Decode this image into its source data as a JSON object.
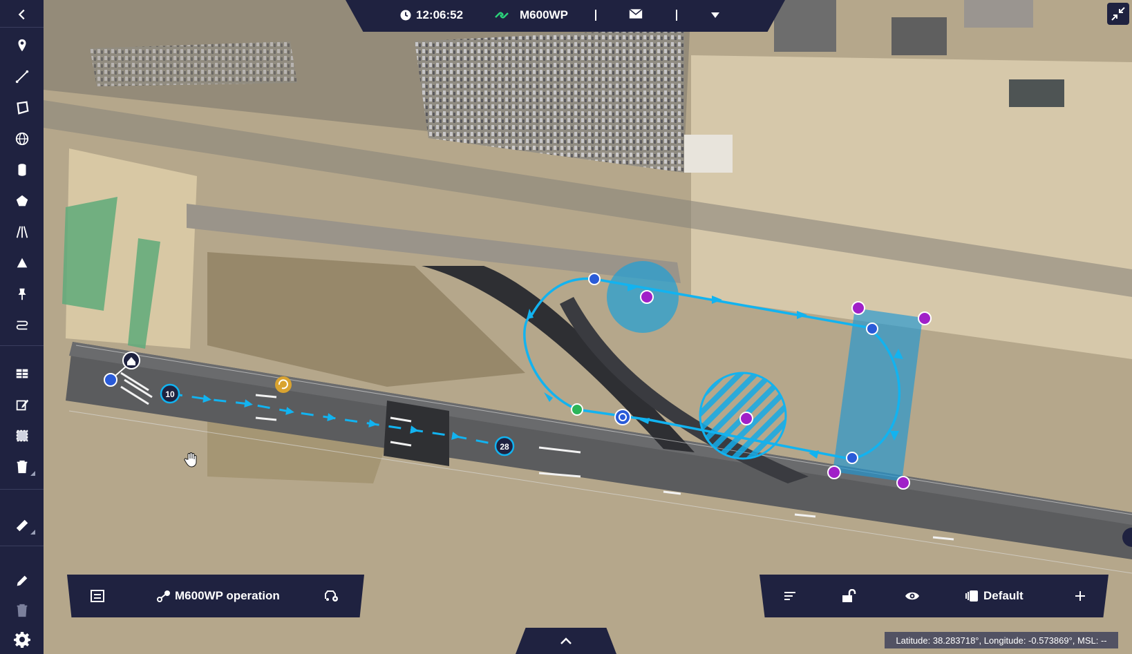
{
  "topbar": {
    "time": "12:06:52",
    "vehicle": "M600WP"
  },
  "sidebar": {
    "tools": [
      "back-icon",
      "marker-icon",
      "line-icon",
      "polygon-icon",
      "globe-icon",
      "cylinder-icon",
      "shape-icon",
      "corridor-icon",
      "cone-icon",
      "pin-icon",
      "route-icon",
      "table-icon",
      "edit-icon",
      "select-area-icon",
      "delete-icon",
      "ruler-icon",
      "pencil-icon",
      "trash-icon",
      "settings-icon"
    ]
  },
  "mission": {
    "start_label": "10",
    "end_label": "28"
  },
  "operation_panel": {
    "title": "M600WP operation"
  },
  "view_panel": {
    "layer_name": "Default"
  },
  "status": {
    "coordinates": "Latitude: 38.283718°, Longitude: -0.573869°, MSL: --"
  },
  "colors": {
    "ui_dark": "#1f2240",
    "route": "#12b3f0",
    "vertex": "#a020c8",
    "waypoint": "#2a5bd8",
    "geofence_fill": "#2aa0d0"
  }
}
